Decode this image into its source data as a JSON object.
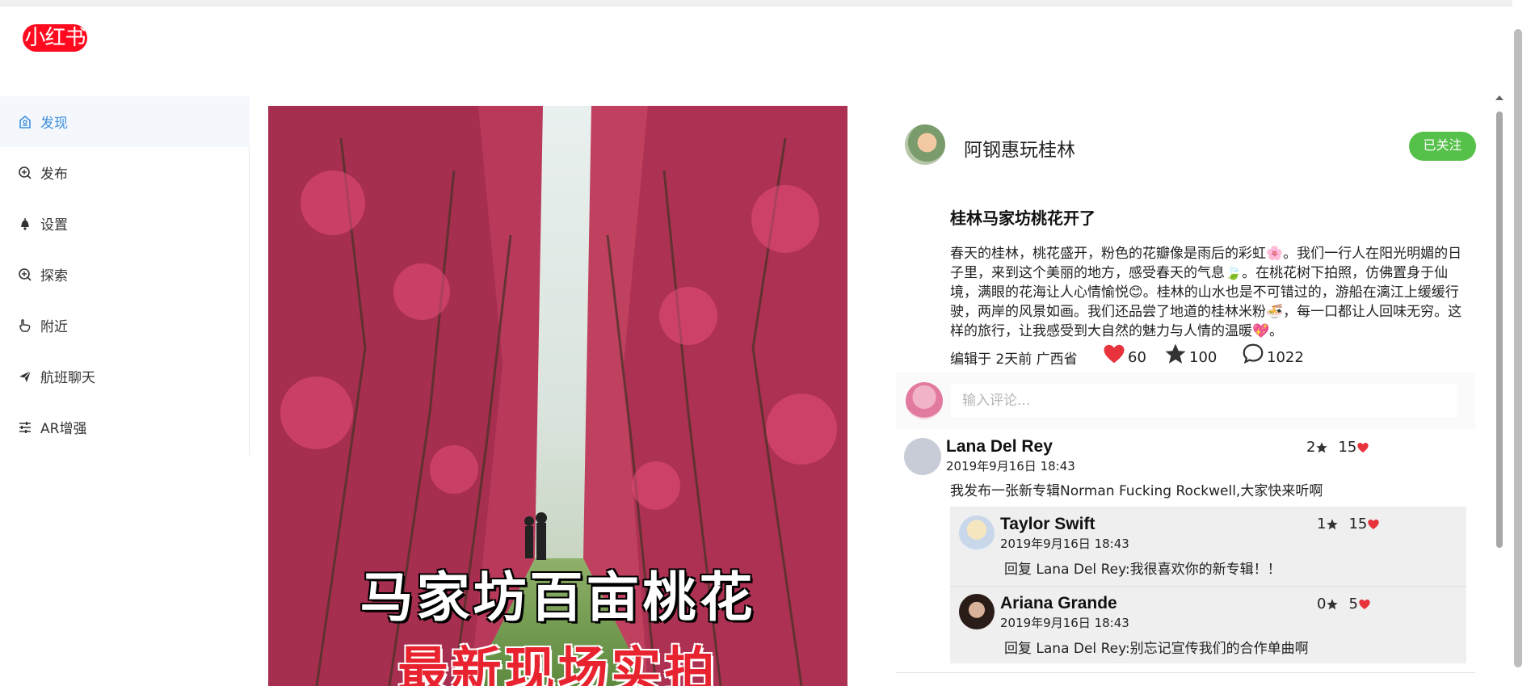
{
  "brand": {
    "logo_text": "小红书"
  },
  "sidebar": {
    "items": [
      {
        "label": "发现",
        "icon": "discover-icon",
        "active": true
      },
      {
        "label": "发布",
        "icon": "publish-icon"
      },
      {
        "label": "设置",
        "icon": "bell-icon"
      },
      {
        "label": "探索",
        "icon": "explore-icon"
      },
      {
        "label": "附近",
        "icon": "hand-icon"
      },
      {
        "label": "航班聊天",
        "icon": "send-icon"
      },
      {
        "label": "AR增强",
        "icon": "sliders-icon"
      }
    ]
  },
  "photo": {
    "caption_line1": "马家坊百亩桃花",
    "caption_line2": "最新现场实拍"
  },
  "post": {
    "author": "阿钢惠玩桂林",
    "follow_label": "已关注",
    "title": "桂林马家坊桃花开了",
    "body": "春天的桂林，桃花盛开，粉色的花瓣像是雨后的彩虹🌸。我们一行人在阳光明媚的日子里，来到这个美丽的地方，感受春天的气息🍃。在桃花树下拍照，仿佛置身于仙境，满眼的花海让人心情愉悦😊。桂林的山水也是不可错过的，游船在漓江上缓缓行驶，两岸的风景如画。我们还品尝了地道的桂林米粉🍜，每一口都让人回味无穷。这样的旅行，让我感受到大自然的魅力与人情的温暖💖。",
    "meta": "编辑于 2天前 广西省",
    "likes": "60",
    "stars": "100",
    "comments": "1022"
  },
  "comment_input": {
    "placeholder": "输入评论..."
  },
  "comments": [
    {
      "name": "Lana Del Rey",
      "time": "2019年9月16日 18:43",
      "text": "我发布一张新专辑Norman Fucking Rockwell,大家快来听啊",
      "stars": "2",
      "likes": "15",
      "replies": [
        {
          "name": "Taylor Swift",
          "time": "2019年9月16日 18:43",
          "text": "回复 Lana Del Rey:我很喜欢你的新专辑！！",
          "stars": "1",
          "likes": "15"
        },
        {
          "name": "Ariana Grande",
          "time": "2019年9月16日 18:43",
          "text": "回复 Lana Del Rey:别忘记宣传我们的合作单曲啊",
          "stars": "0",
          "likes": "5"
        }
      ]
    }
  ],
  "colors": {
    "brand": "#ff0a1e",
    "follow": "#55c04a",
    "active_nav": "#3f8fe0",
    "heart": "#e8323c"
  }
}
